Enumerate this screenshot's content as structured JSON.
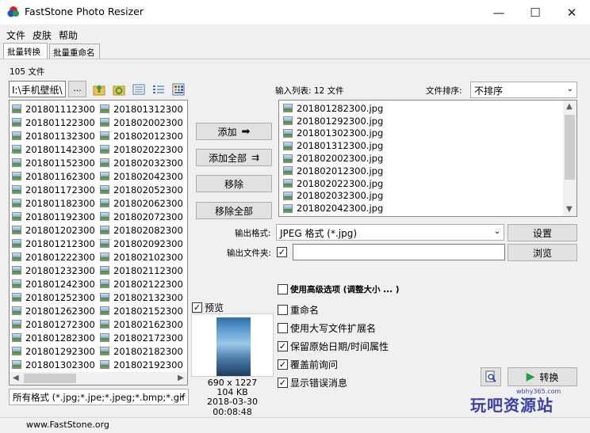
{
  "window": {
    "title": "FastStone Photo Resizer",
    "minimize": "—",
    "maximize": "☐",
    "close": "✕"
  },
  "menu": [
    "文件",
    "皮肤",
    "帮助"
  ],
  "tabs": [
    "批量转换",
    "批量重命名"
  ],
  "source": {
    "file_count": "105 文件",
    "path": "I:\\手机壁纸\\",
    "browse_label": "...",
    "files_col1": [
      "201801112300",
      "201801122300",
      "201801132300",
      "201801142300",
      "201801152300",
      "201801162300",
      "201801172300",
      "201801182300",
      "201801192300",
      "201801202300",
      "201801212300",
      "201801222300",
      "201801232300",
      "201801242300",
      "201801252300",
      "201801262300",
      "201801272300",
      "201801282300",
      "201801292300",
      "201801302300"
    ],
    "files_col2": [
      "201801312300",
      "201802002300",
      "201802012300",
      "201802022300",
      "201802032300",
      "201802042300",
      "201802052300",
      "201802062300",
      "201802072300",
      "201802082300",
      "201802092300",
      "201802102300",
      "201802112300",
      "201802122300",
      "201802132300",
      "201802152300",
      "201802162300",
      "201802172300",
      "201802182300",
      "201802192300"
    ],
    "filter": "所有格式 (*.jpg;*.jpe;*.jpeg;*.bmp;*.gif"
  },
  "actions": {
    "add": "添加",
    "add_all": "添加全部",
    "remove": "移除",
    "remove_all": "移除全部"
  },
  "input_list": {
    "label": "输入列表: 12 文件",
    "sort_label": "文件排序:",
    "sort_value": "不排序",
    "files": [
      "201801282300.jpg",
      "201801292300.jpg",
      "201801302300.jpg",
      "201801312300.jpg",
      "201802002300.jpg",
      "201802012300.jpg",
      "201802022300.jpg",
      "201802032300.jpg",
      "201802042300.jpg"
    ]
  },
  "output": {
    "format_label": "输出格式:",
    "format_value": "JPEG 格式 (*.jpg)",
    "settings": "设置",
    "folder_label": "输出文件夹:",
    "folder_value": "",
    "browse": "浏览"
  },
  "options": {
    "advanced": "使用高级选项 (调整大小 ... )",
    "rename": "重命名",
    "uppercase_ext": "使用大写文件扩展名",
    "keep_date": "保留原始日期/时间属性",
    "overwrite_ask": "覆盖前询问",
    "show_errors": "显示错误消息"
  },
  "preview": {
    "label": "预览",
    "dimensions": "690 x 1227",
    "size": "104 KB",
    "date": "2018-03-30 00:08:48"
  },
  "convert": "转换",
  "status": {
    "site": "www.FastStone.org"
  },
  "watermark": {
    "main": "玩吧资源站",
    "sub": "wbhy365.com"
  }
}
